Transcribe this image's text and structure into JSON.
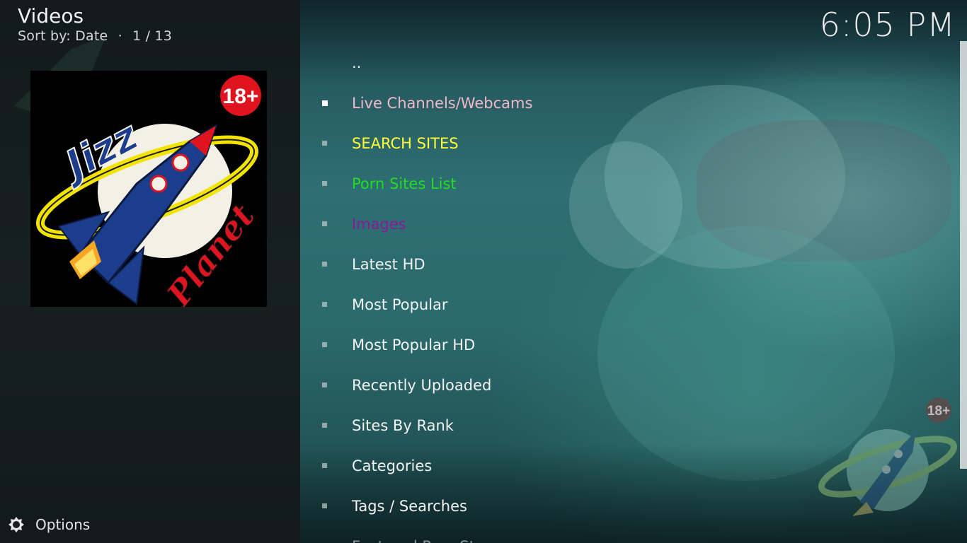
{
  "header": {
    "title": "Videos",
    "sort_label": "Sort by: Date",
    "separator": "·",
    "position": "1 / 13",
    "clock": "6:05 PM"
  },
  "thumbnail": {
    "logo_text_top": "Jizz",
    "logo_text_bottom": "Planet",
    "badge": "18+",
    "icon": "rocket-icon"
  },
  "watermark": {
    "badge": "18+"
  },
  "footer": {
    "options_label": "Options",
    "options_icon": "gear-icon"
  },
  "list": {
    "items": [
      {
        "label": "..",
        "color": "#e8e8e8",
        "bullet": false
      },
      {
        "label": "Live Channels/Webcams",
        "color": "#f3b8c8",
        "bullet": true,
        "selected": true
      },
      {
        "label": "SEARCH SITES",
        "color": "#ffff33",
        "bullet": true
      },
      {
        "label": "Porn Sites List",
        "color": "#22dd22",
        "bullet": true
      },
      {
        "label": "Images",
        "color": "#8a1a9a",
        "bullet": true
      },
      {
        "label": "Latest HD",
        "color": "#f2f2f2",
        "bullet": true
      },
      {
        "label": "Most Popular",
        "color": "#f2f2f2",
        "bullet": true
      },
      {
        "label": "Most Popular HD",
        "color": "#f2f2f2",
        "bullet": true
      },
      {
        "label": "Recently Uploaded",
        "color": "#f2f2f2",
        "bullet": true
      },
      {
        "label": "Sites By Rank",
        "color": "#f2f2f2",
        "bullet": true
      },
      {
        "label": "Categories",
        "color": "#f2f2f2",
        "bullet": true
      },
      {
        "label": "Tags / Searches",
        "color": "#f2f2f2",
        "bullet": true
      },
      {
        "label": "Featured Porn Stars",
        "color": "#f2f2f2",
        "bullet": true
      }
    ]
  },
  "colors": {
    "panel_bg": "#151d1e",
    "accent_red": "#e0141e",
    "rocket_blue": "#1b3d8c",
    "ring_yellow": "#f2e400"
  }
}
